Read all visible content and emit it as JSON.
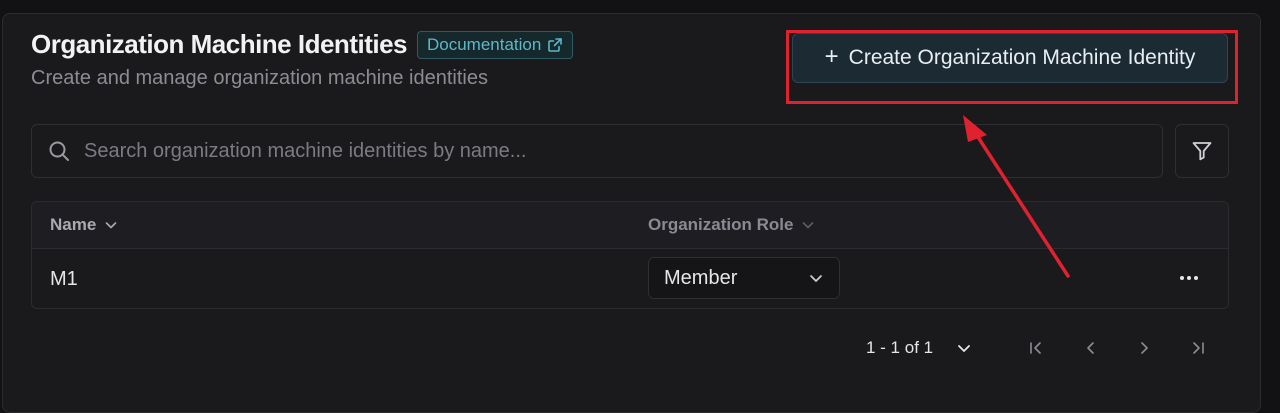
{
  "header": {
    "title": "Organization Machine Identities",
    "doc_label": "Documentation",
    "subtitle": "Create and manage organization machine identities",
    "create_label": "Create Organization Machine Identity"
  },
  "search": {
    "placeholder": "Search organization machine identities by name..."
  },
  "table": {
    "columns": [
      "Name",
      "Organization Role"
    ],
    "rows": [
      {
        "name": "M1",
        "role": "Member"
      }
    ]
  },
  "pagination": {
    "info": "1 - 1 of 1"
  },
  "annotation": {
    "highlight_color": "#e0212f"
  }
}
